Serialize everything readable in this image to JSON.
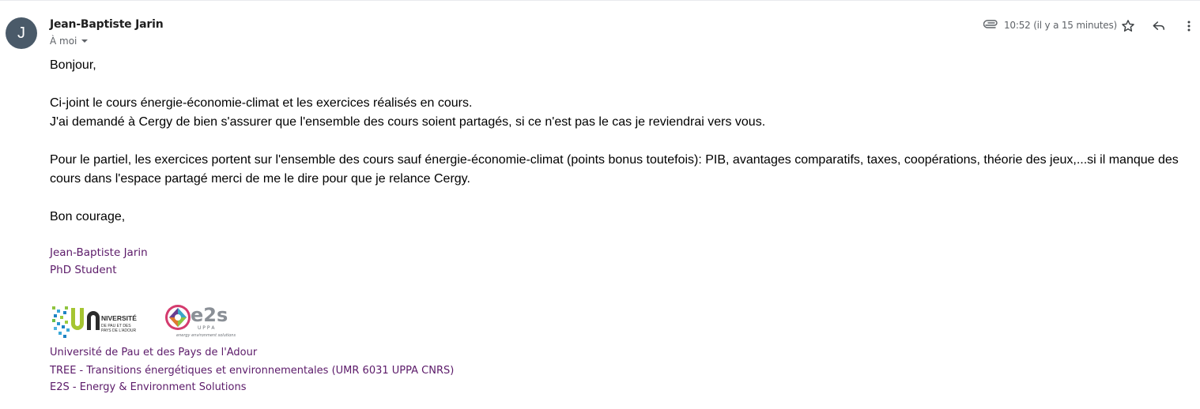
{
  "sender": {
    "initial": "J",
    "avatar_color": "#4a5a69",
    "name": "Jean-Baptiste Jarin",
    "recipient_label": "À moi"
  },
  "header": {
    "timestamp": "10:52 (il y a 15 minutes)",
    "attachment_icon": "paperclip-icon",
    "star_icon": "star-icon",
    "reply_icon": "reply-icon",
    "more_icon": "more-vertical-icon"
  },
  "body": {
    "greeting": "Bonjour,",
    "para1_line1": "Ci-joint le cours énergie-économie-climat et les exercices réalisés en cours.",
    "para1_line2": "J'ai demandé à Cergy de bien s'assurer que l'ensemble des cours soient partagés, si ce n'est pas le cas je reviendrai vers vous.",
    "para2": "Pour le partiel, les exercices portent sur l'ensemble des cours sauf énergie-économie-climat (points bonus toutefois): PIB, avantages comparatifs, taxes, coopérations, théorie des jeux,...si il manque des cours dans l'espace partagé merci de me le dire pour que je relance Cergy.",
    "closing": "Bon courage,"
  },
  "signature": {
    "name": "Jean-Baptiste Jarin",
    "title": "PhD Student",
    "color": "#5b1a69",
    "logo_upp": {
      "text_main": "NIVERSITÉ",
      "text_sub1": "DE PAU ET DES",
      "text_sub2": "PAYS DE L'ADOUR"
    },
    "logo_e2s": {
      "text_main": "e2s",
      "text_sub": "U P P A",
      "tagline": "energy environment solutions"
    },
    "affiliations": [
      "Université de Pau et des Pays de l'Adour",
      "TREE - Transitions énergétiques et environnementales (UMR 6031 UPPA CNRS)",
      "E2S - Energy & Environment Solutions"
    ]
  }
}
